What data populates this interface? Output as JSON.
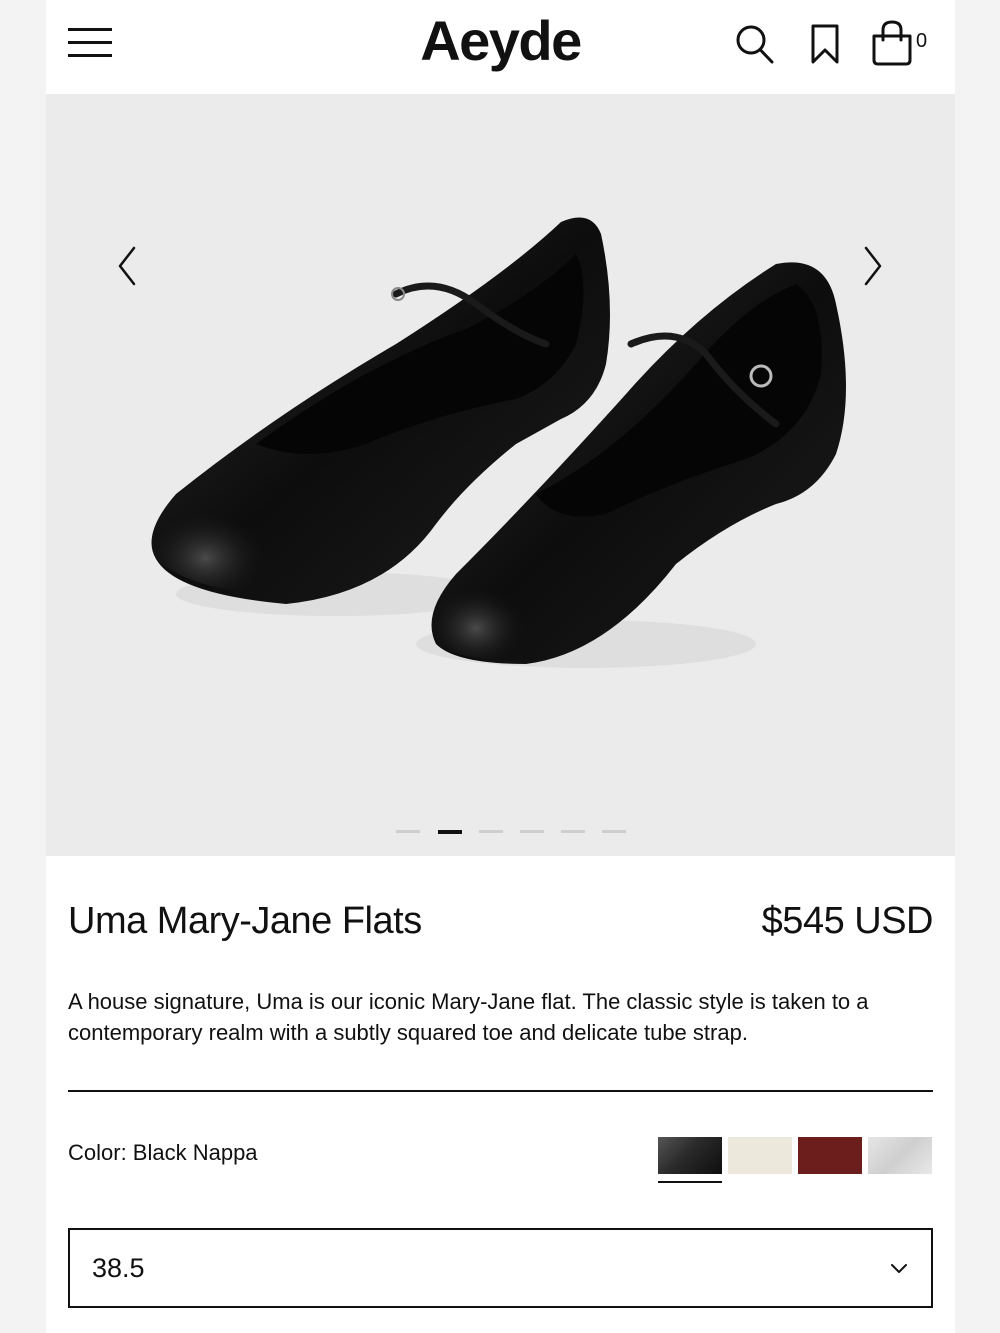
{
  "header": {
    "logo": "Aeyde",
    "menu_icon": "hamburger-menu-icon",
    "search_icon": "search-icon",
    "wishlist_icon": "bookmark-icon",
    "bag_icon": "shopping-bag-icon",
    "bag_count": "0"
  },
  "gallery": {
    "prev_icon": "chevron-left-icon",
    "next_icon": "chevron-right-icon",
    "slide_count": 6,
    "active_slide": 2,
    "background": "#ebebeb"
  },
  "product": {
    "name": "Uma Mary-Jane Flats",
    "price": "$545 USD",
    "description": "A house signature, Uma is our iconic Mary-Jane flat. The classic style is taken to a contemporary realm with a subtly squared toe and delicate tube strap.",
    "color_label": "Color: Black Nappa",
    "swatches": [
      {
        "color": "#2a2a2a",
        "selected": true
      },
      {
        "color": "#ede8dc",
        "selected": false
      },
      {
        "color": "#6b1e1c",
        "selected": false
      },
      {
        "color": "#dedede",
        "selected": false
      }
    ],
    "size": "38.5"
  }
}
